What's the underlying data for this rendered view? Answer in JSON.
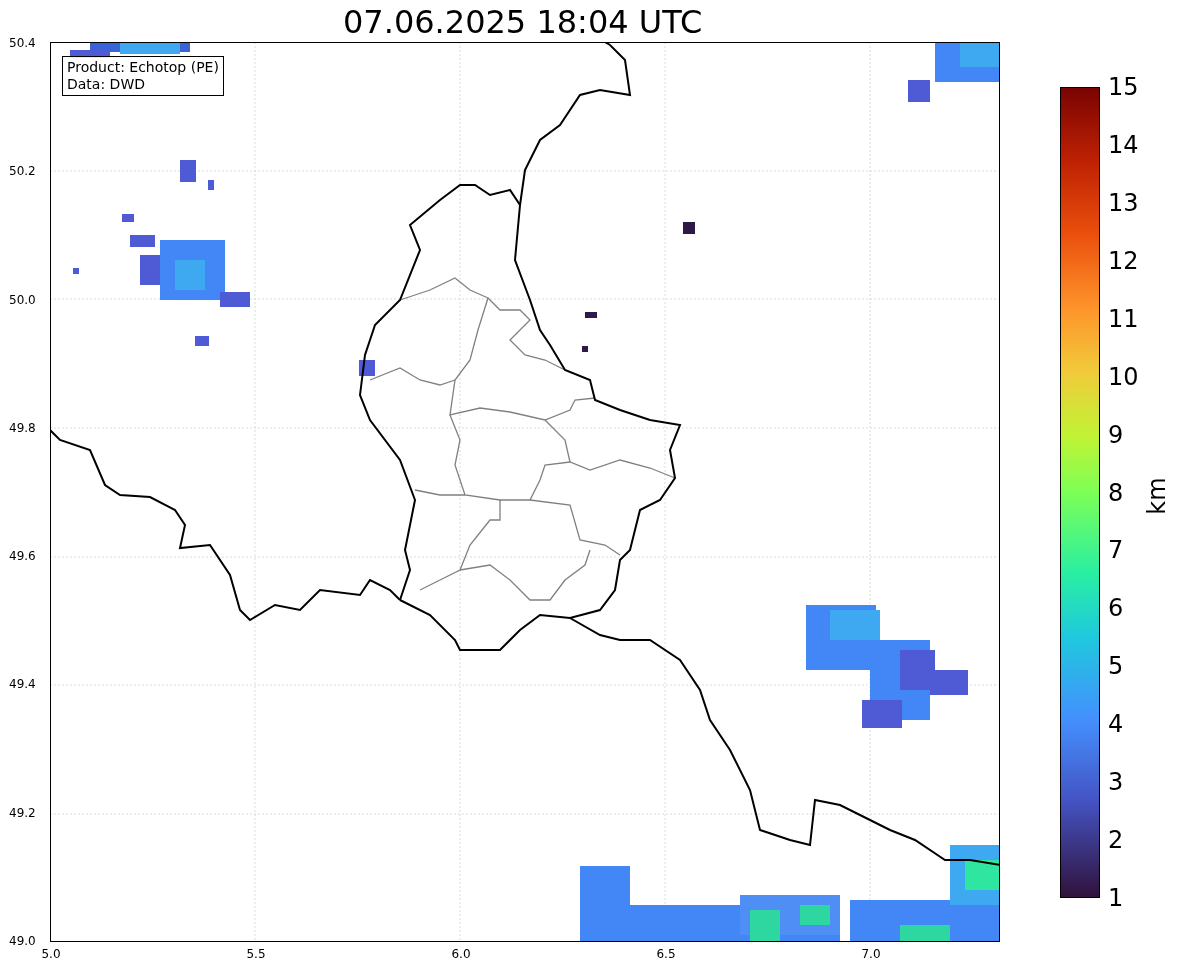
{
  "title": "07.06.2025 18:04 UTC",
  "info_box": [
    "Product: Echotop (PE)",
    "Data: DWD"
  ],
  "map": {
    "x_ticks": [
      "5.0",
      "5.5",
      "6.0",
      "6.5",
      "7.0"
    ],
    "y_ticks": [
      "50.4",
      "50.2",
      "50.0",
      "49.8",
      "49.6",
      "49.4",
      "49.2",
      "49.0"
    ]
  },
  "colorbar": {
    "label": "km",
    "ticks": [
      "15",
      "14",
      "13",
      "12",
      "11",
      "10",
      "9",
      "8",
      "7",
      "6",
      "5",
      "4",
      "3",
      "2",
      "1"
    ]
  }
}
